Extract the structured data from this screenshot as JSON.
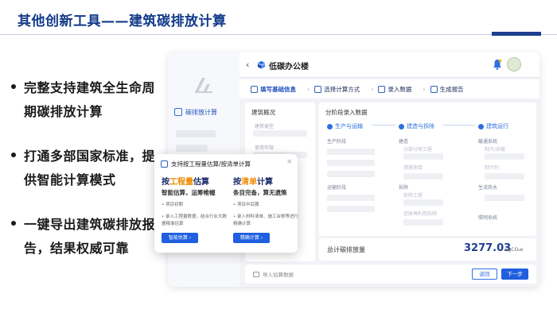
{
  "slide": {
    "title": "其他创新工具——建筑碳排放计算",
    "bullets": [
      "完整支持建筑全生命周期碳排放计算",
      "打通多部国家标准，提供智能计算模式",
      "一键导出建筑碳排放报告，结果权威可靠"
    ]
  },
  "app": {
    "sidebar": {
      "item": "碳排放计算"
    },
    "header": {
      "back": "‹",
      "project_name": "低碳办公楼"
    },
    "steps": [
      {
        "label": "填写基础信息"
      },
      {
        "label": "选择计算方式"
      },
      {
        "label": "录入数据"
      },
      {
        "label": "生成报告"
      }
    ],
    "overview": {
      "title": "建筑概况",
      "fields": [
        "建筑类型",
        "使用年限"
      ]
    },
    "phases_panel": {
      "title": "分阶段录入数据",
      "phases": [
        "生产与运输",
        "建造与拆除",
        "建筑运行"
      ],
      "col1": {
        "h1": "生产阶段",
        "h2": "运输阶段"
      },
      "col2": {
        "h1": "建造",
        "s1": "分部分项工程",
        "s2": "措施项目",
        "h2": "拆除",
        "s3": "拆除工程",
        "s4": "还原再利用拆除"
      },
      "col3": {
        "h1": "暖通系统",
        "s1": "制冷/采暖",
        "s2": "制冷剂",
        "h2": "生活热水",
        "h3": "照明系统"
      }
    },
    "total": {
      "label": "总计碳排放量",
      "value": "3277.03",
      "unit": "kgCO₂e"
    },
    "footer": {
      "import": "导入估算数据",
      "back": "返回",
      "next": "下一步"
    },
    "popup": {
      "title": "支持按工程量估算/按清单计算",
      "close": "×",
      "left": {
        "title_pre": "按",
        "title_hl": "工程量",
        "title_post": "估算",
        "subtitle": "智能估算，运筹帷幄",
        "line1": "• 项目初期",
        "line2": "• 录入工程量数据，结合行业大数据精准估算",
        "button": "智能估算 ›"
      },
      "right": {
        "title_pre": "按",
        "title_hl": "清单",
        "title_post": "计算",
        "subtitle": "条目完备，算无遗策",
        "line1": "• 项目中后期",
        "line2": "• 录入材料清单、施工台账等进行精确计算",
        "button": "精确计算 ›"
      }
    }
  }
}
